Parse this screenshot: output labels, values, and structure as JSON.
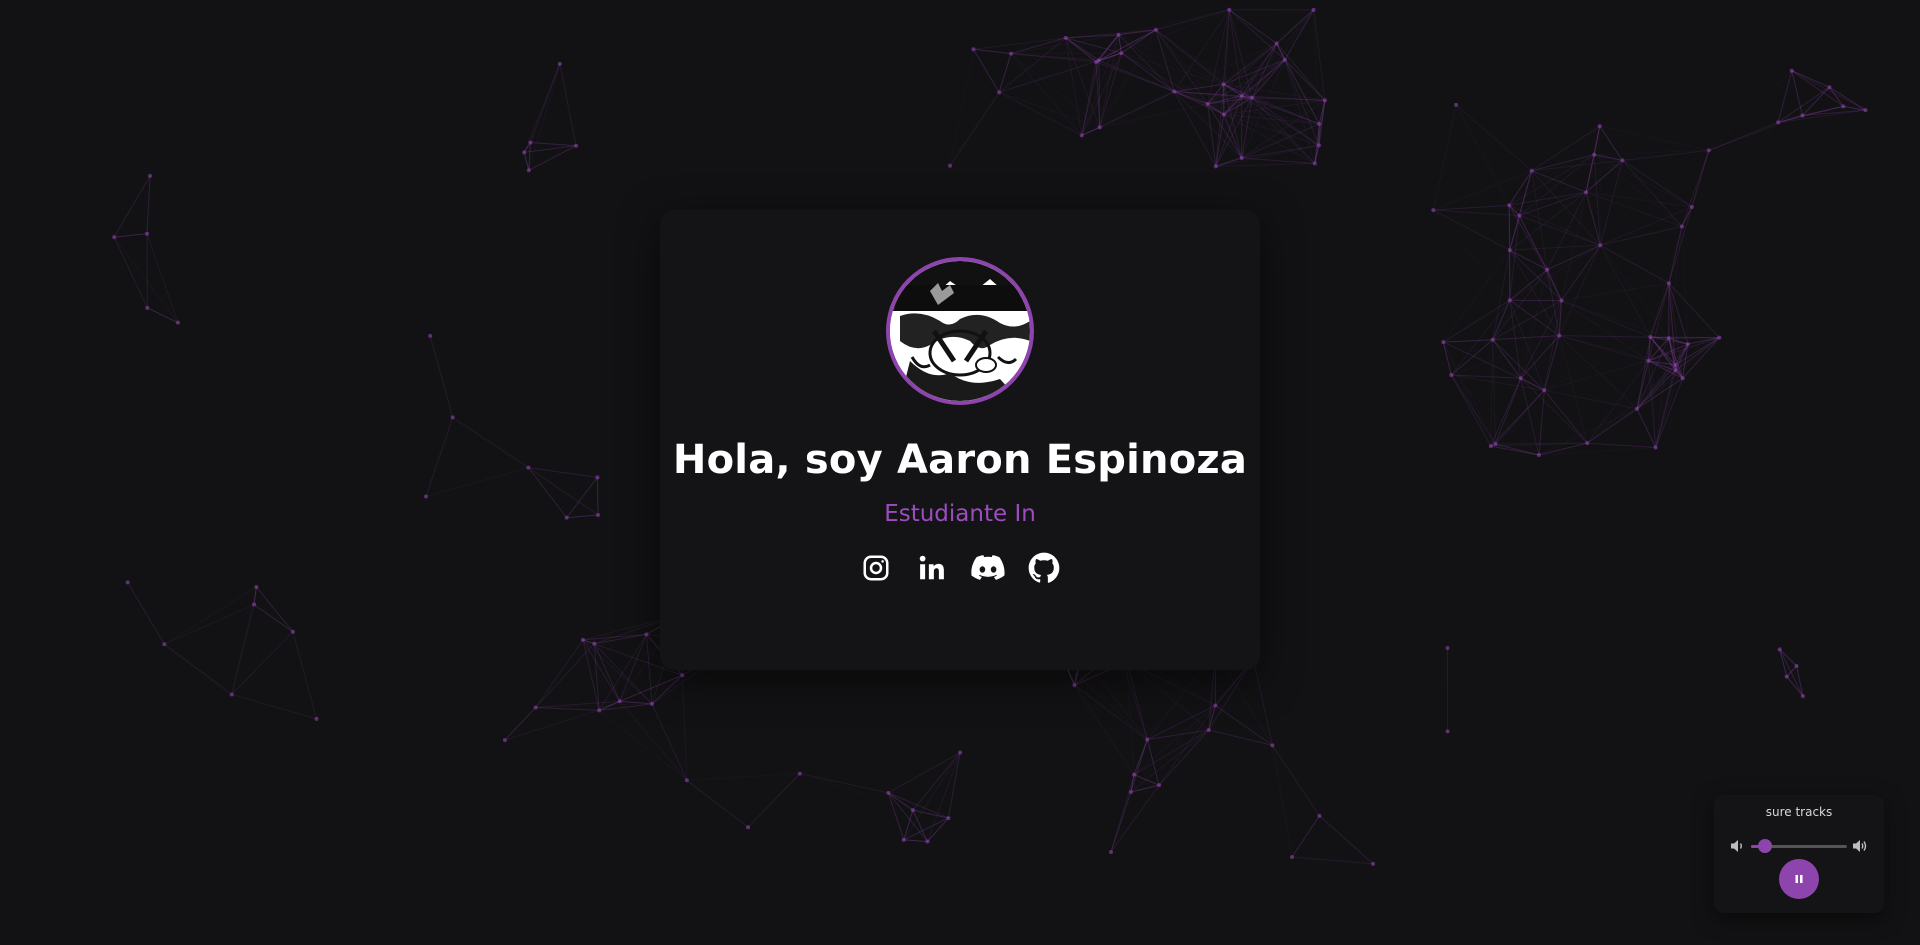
{
  "profile": {
    "headline": "Hola, soy Aaron Espinoza",
    "subtitle": "Estudiante In",
    "avatar_icon": "avatar-illustration",
    "accent_color": "#8e44ad",
    "subtitle_color": "#9b4dbf"
  },
  "socials": [
    {
      "name": "Instagram",
      "icon": "instagram-icon"
    },
    {
      "name": "LinkedIn",
      "icon": "linkedin-icon"
    },
    {
      "name": "Discord",
      "icon": "discord-icon"
    },
    {
      "name": "GitHub",
      "icon": "github-icon"
    }
  ],
  "player": {
    "track_title": "sure tracks",
    "volume": 0.15,
    "state": "playing",
    "button_icon": "pause-icon",
    "volume_down_icon": "volume-low-icon",
    "volume_up_icon": "volume-high-icon"
  },
  "background": {
    "color": "#121214",
    "network_color": "#8e44ad"
  }
}
